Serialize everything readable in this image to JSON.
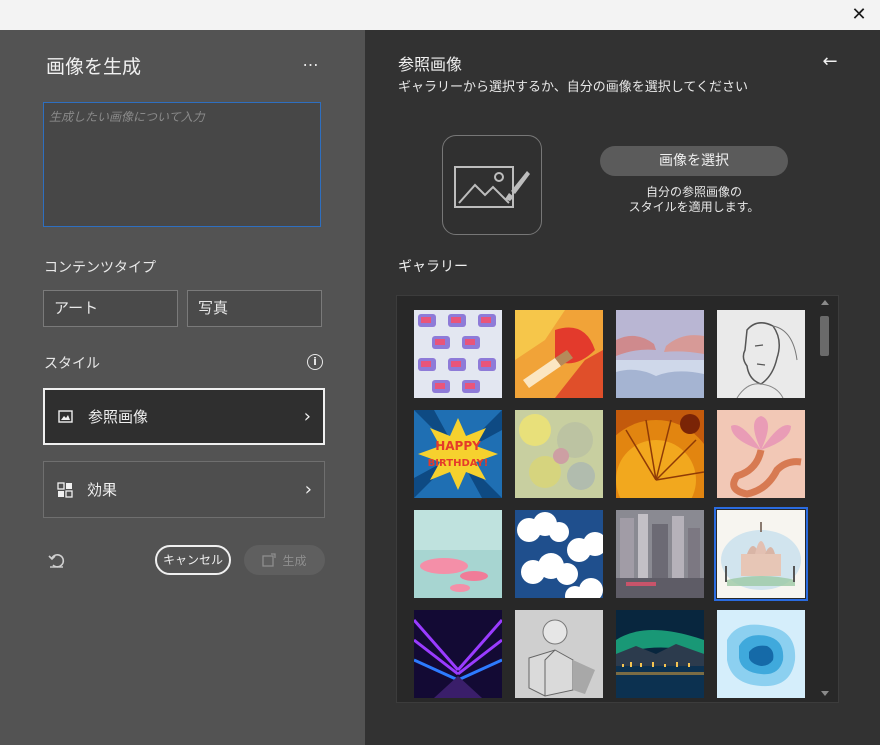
{
  "window": {
    "close_icon": "close-icon"
  },
  "left": {
    "title": "画像を生成",
    "more_label": "…",
    "prompt": {
      "placeholder": "生成したい画像について入力"
    },
    "content_type_label": "コンテンツタイプ",
    "content_types": [
      "アート",
      "写真"
    ],
    "style_label": "スタイル",
    "style_rows": [
      {
        "label": "参照画像",
        "icon": "image-reference-icon",
        "selected": true
      },
      {
        "label": "効果",
        "icon": "effects-icon",
        "selected": false
      }
    ],
    "cancel_label": "キャンセル",
    "generate_label": "生成"
  },
  "right": {
    "title": "参照画像",
    "subtitle": "ギャラリーから選択するか、自分の画像を選択してください",
    "select_button": "画像を選択",
    "select_desc_line1": "自分の参照画像の",
    "select_desc_line2": "スタイルを適用します。",
    "gallery_label": "ギャラリー",
    "gallery": [
      {
        "name": "tv-pattern-thumb"
      },
      {
        "name": "paint-brush-thumb"
      },
      {
        "name": "creation-hands-thumb"
      },
      {
        "name": "pencil-portrait-thumb"
      },
      {
        "name": "happy-birthday-comic-thumb"
      },
      {
        "name": "abstract-paint-thumb"
      },
      {
        "name": "citrus-macro-thumb"
      },
      {
        "name": "abstract-flower-thumb"
      },
      {
        "name": "pink-discs-thumb"
      },
      {
        "name": "clouds-pattern-thumb"
      },
      {
        "name": "blurred-city-thumb"
      },
      {
        "name": "watercolor-cathedral-thumb",
        "selected": true
      },
      {
        "name": "neon-corridor-thumb"
      },
      {
        "name": "geometric-shapes-sketch-thumb"
      },
      {
        "name": "aurora-city-thumb"
      },
      {
        "name": "paper-cut-layers-thumb"
      }
    ]
  }
}
